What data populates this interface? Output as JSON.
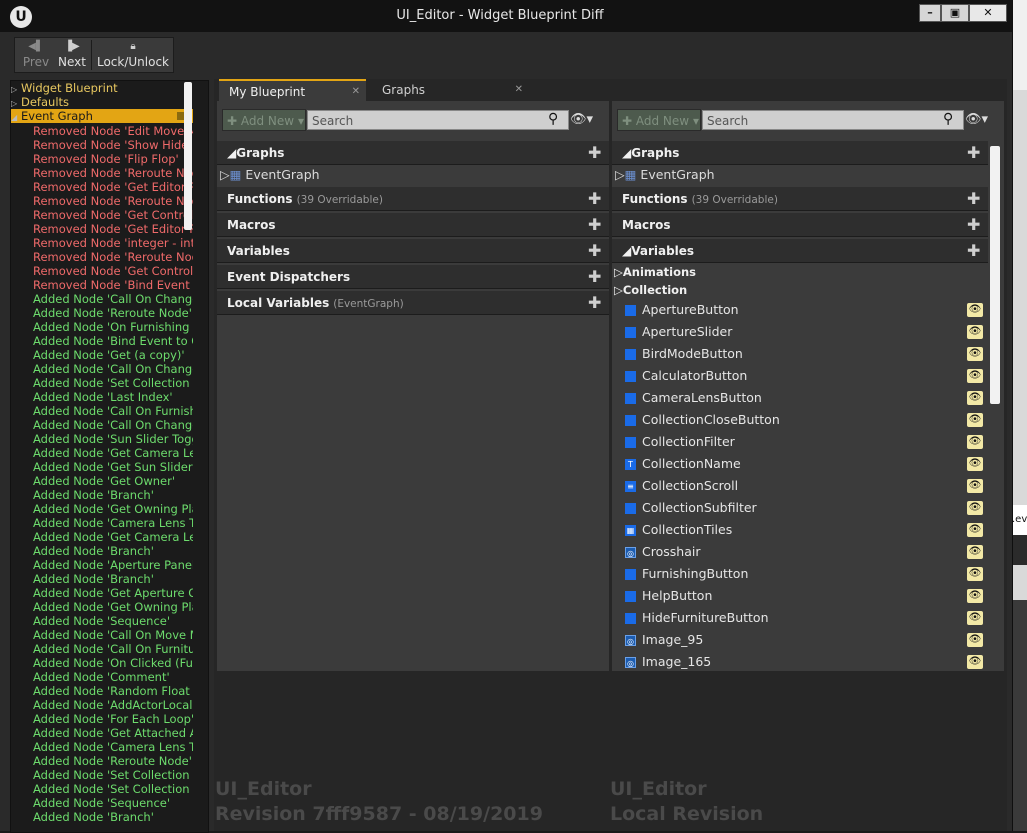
{
  "window": {
    "title": "UI_Editor - Widget Blueprint Diff",
    "logo": "U"
  },
  "toolbar": {
    "prev": "Prev",
    "next": "Next",
    "lock": "Lock/Unlock"
  },
  "tree": {
    "headers": [
      "Widget Blueprint",
      "Defaults",
      "Event Graph"
    ],
    "items": [
      {
        "t": "Removed Node 'Edit Move Mo",
        "k": "removed"
      },
      {
        "t": "Removed Node 'Show Hide Fu",
        "k": "removed"
      },
      {
        "t": "Removed Node 'Flip Flop'",
        "k": "removed"
      },
      {
        "t": "Removed Node 'Reroute Node",
        "k": "removed"
      },
      {
        "t": "Removed Node 'Get Editor PC",
        "k": "removed"
      },
      {
        "t": "Removed Node 'Reroute Node",
        "k": "removed"
      },
      {
        "t": "Removed Node 'Get Controlle",
        "k": "removed"
      },
      {
        "t": "Removed Node 'Get Editor PC",
        "k": "removed"
      },
      {
        "t": "Removed Node 'integer - integ",
        "k": "removed"
      },
      {
        "t": "Removed Node 'Reroute Node",
        "k": "removed"
      },
      {
        "t": "Removed Node 'Get Controlle",
        "k": "removed"
      },
      {
        "t": "Removed Node 'Bind Event to",
        "k": "removed"
      },
      {
        "t": "Added Node 'Call On Change",
        "k": "added"
      },
      {
        "t": "Added Node 'Reroute Node'",
        "k": "added"
      },
      {
        "t": "Added Node 'On Furnishing T",
        "k": "added"
      },
      {
        "t": "Added Node 'Bind Event to Or",
        "k": "added"
      },
      {
        "t": "Added Node 'Get (a copy)'",
        "k": "added"
      },
      {
        "t": "Added Node 'Call On Change",
        "k": "added"
      },
      {
        "t": "Added Node 'Set Collection St",
        "k": "added"
      },
      {
        "t": "Added Node 'Last Index'",
        "k": "added"
      },
      {
        "t": "Added Node 'Call On Furnishi",
        "k": "added"
      },
      {
        "t": "Added Node 'Call On Change",
        "k": "added"
      },
      {
        "t": "Added Node 'Sun Slider Togg",
        "k": "added"
      },
      {
        "t": "Added Node 'Get Camera Len",
        "k": "added"
      },
      {
        "t": "Added Node 'Get Sun Slider O",
        "k": "added"
      },
      {
        "t": "Added Node 'Get Owner'",
        "k": "added"
      },
      {
        "t": "Added Node 'Branch'",
        "k": "added"
      },
      {
        "t": "Added Node 'Get Owning Play",
        "k": "added"
      },
      {
        "t": "Added Node 'Camera Lens To",
        "k": "added"
      },
      {
        "t": "Added Node 'Get Camera Len",
        "k": "added"
      },
      {
        "t": "Added Node 'Branch'",
        "k": "added"
      },
      {
        "t": "Added Node 'Aperture Panel T",
        "k": "added"
      },
      {
        "t": "Added Node 'Branch'",
        "k": "added"
      },
      {
        "t": "Added Node 'Get Aperture Ope",
        "k": "added"
      },
      {
        "t": "Added Node 'Get Owning Play",
        "k": "added"
      },
      {
        "t": "Added Node 'Sequence'",
        "k": "added"
      },
      {
        "t": "Added Node 'Call On Move Mo",
        "k": "added"
      },
      {
        "t": "Added Node 'Call On Furnitur",
        "k": "added"
      },
      {
        "t": "Added Node 'On Clicked (Furr",
        "k": "added"
      },
      {
        "t": "Added Node 'Comment'",
        "k": "added"
      },
      {
        "t": "Added Node 'Random Float in",
        "k": "added"
      },
      {
        "t": "Added Node 'AddActorLocalO",
        "k": "added"
      },
      {
        "t": "Added Node 'For Each Loop'",
        "k": "added"
      },
      {
        "t": "Added Node 'Get Attached Ac",
        "k": "added"
      },
      {
        "t": "Added Node 'Camera Lens To",
        "k": "added"
      },
      {
        "t": "Added Node 'Reroute Node'",
        "k": "added"
      },
      {
        "t": "Added Node 'Set Collection St",
        "k": "added"
      },
      {
        "t": "Added Node 'Set Collection St",
        "k": "added"
      },
      {
        "t": "Added Node 'Sequence'",
        "k": "added"
      },
      {
        "t": "Added Node 'Branch'",
        "k": "added"
      }
    ]
  },
  "tabs": [
    {
      "label": "My Blueprint",
      "close": "✕"
    },
    {
      "label": "Graphs",
      "close": "✕"
    }
  ],
  "pane": {
    "add_new": "Add New",
    "search_placeholder": "Search",
    "sections": {
      "graphs": "Graphs",
      "event_graph": "EventGraph",
      "functions": "Functions",
      "functions_sub": "(39 Overridable)",
      "macros": "Macros",
      "variables": "Variables",
      "event_dispatchers": "Event Dispatchers",
      "local_variables": "Local Variables",
      "local_variables_sub": "(EventGraph)"
    },
    "var_groups": [
      "Animations",
      "Collection"
    ],
    "vars": [
      {
        "name": "ApertureButton",
        "icon": "button-icon"
      },
      {
        "name": "ApertureSlider",
        "icon": "slider-icon"
      },
      {
        "name": "BirdModeButton",
        "icon": "button-icon"
      },
      {
        "name": "CalculatorButton",
        "icon": "button-icon"
      },
      {
        "name": "CameraLensButton",
        "icon": "button-icon"
      },
      {
        "name": "CollectionCloseButton",
        "icon": "button-icon"
      },
      {
        "name": "CollectionFilter",
        "icon": "button-icon"
      },
      {
        "name": "CollectionName",
        "icon": "text-icon"
      },
      {
        "name": "CollectionScroll",
        "icon": "scrollbox-icon"
      },
      {
        "name": "CollectionSubfilter",
        "icon": "button-icon"
      },
      {
        "name": "CollectionTiles",
        "icon": "tileview-icon"
      },
      {
        "name": "Crosshair",
        "icon": "image-icon"
      },
      {
        "name": "FurnishingButton",
        "icon": "button-icon"
      },
      {
        "name": "HelpButton",
        "icon": "button-icon"
      },
      {
        "name": "HideFurnitureButton",
        "icon": "button-icon"
      },
      {
        "name": "Image_95",
        "icon": "image-icon"
      },
      {
        "name": "Image_165",
        "icon": "image-icon"
      }
    ]
  },
  "footer": {
    "left_name": "UI_Editor",
    "left_rev": "Revision 7fff9587 - 08/19/2019",
    "right_name": "UI_Editor",
    "right_rev": "Local Revision"
  }
}
